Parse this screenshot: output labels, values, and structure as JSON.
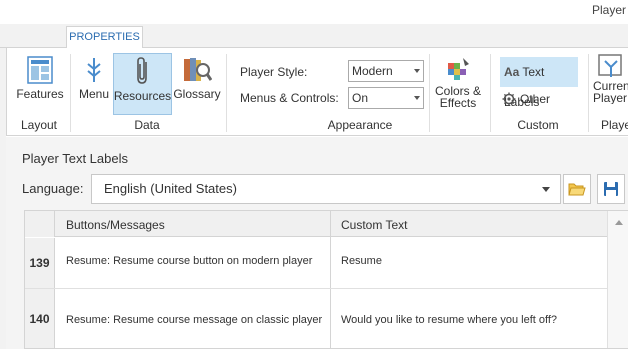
{
  "app": {
    "title_fragment": "Player"
  },
  "ribbon": {
    "tab": "PROPERTIES",
    "buttons": {
      "features": "Features",
      "menu": "Menu",
      "resources": "Resources",
      "glossary": "Glossary",
      "colors_effects": "Colors & Effects",
      "text_labels": "Text Labels",
      "other": "Other",
      "current_player": "Current Player"
    },
    "groups": {
      "layout": "Layout",
      "data": "Data",
      "appearance": "Appearance",
      "custom": "Custom",
      "player": "Playe"
    },
    "player_style": {
      "label": "Player Style:",
      "value": "Modern"
    },
    "menus_controls": {
      "label": "Menus & Controls:",
      "value": "On"
    }
  },
  "panel": {
    "title": "Player Text Labels",
    "language_label": "Language:",
    "language_value": "English (United States)"
  },
  "grid": {
    "columns": [
      "Buttons/Messages",
      "Custom Text"
    ],
    "rows": [
      {
        "id": "139",
        "message": "Resume: Resume course button on modern player",
        "custom": "Resume"
      },
      {
        "id": "140",
        "message": "Resume: Resume course message on classic player",
        "custom": "Would you like to resume where you left off?"
      }
    ]
  },
  "colors": {
    "accent": "#2b6cb0",
    "selected_bg": "#cde6f7"
  },
  "icons": [
    "features-icon",
    "menu-icon",
    "resources-icon",
    "glossary-icon",
    "colors-effects-icon",
    "gear-icon",
    "current-player-icon",
    "open-folder-icon",
    "save-icon"
  ]
}
